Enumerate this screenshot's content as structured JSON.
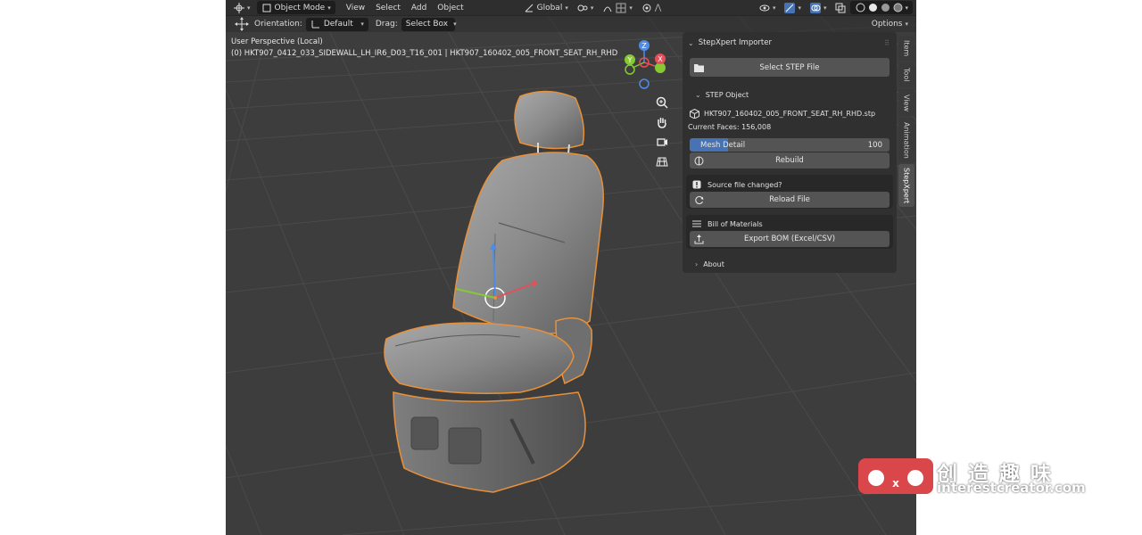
{
  "header": {
    "mode": "Object Mode",
    "menus": [
      "View",
      "Select",
      "Add",
      "Object"
    ],
    "transform_orientation": "Global",
    "icons": [
      "editor-type-icon",
      "object-mode-icon",
      "transform-orientation-icon",
      "pivot-icon",
      "snap-icon",
      "proportional-edit-icon",
      "visibility-icon",
      "gizmo-icon",
      "overlay-icon",
      "xray-icon",
      "shading-wireframe-icon",
      "shading-solid-icon",
      "shading-material-icon",
      "shading-rendered-icon"
    ]
  },
  "toolbar": {
    "orientation_label": "Orientation:",
    "orientation_value": "Default",
    "drag_label": "Drag:",
    "drag_value": "Select Box",
    "options_label": "Options"
  },
  "viewport": {
    "perspective": "User Perspective (Local)",
    "object_info": "(0) HKT907_0412_033_SIDEWALL_LH_IR6_D03_T16_001 | HKT907_160402_005_FRONT_SEAT_RH_RHD",
    "gizmo_labels": {
      "x": "X",
      "y": "Y",
      "z": "Z"
    },
    "nav_icons": [
      "zoom-icon",
      "pan-icon",
      "camera-icon",
      "grid-view-icon"
    ],
    "axis_colors": {
      "x": "#e44f5a",
      "y": "#86c933",
      "z": "#4d8de8"
    }
  },
  "panel": {
    "title": "StepXpert Importer",
    "select_step_label": "Select STEP File",
    "step_object_title": "STEP Object",
    "file_name": "HKT907_160402_005_FRONT_SEAT_RH_RHD.stp",
    "current_faces": "Current Faces: 156,008",
    "mesh_detail_label": "Mesh Detail",
    "mesh_detail_value": "100",
    "mesh_detail_fill": 0.19,
    "rebuild_label": "Rebuild",
    "source_changed": "Source file changed?",
    "reload_label": "Reload File",
    "bom_title": "Bill of Materials",
    "export_bom_label": "Export BOM (Excel/CSV)",
    "about_label": "About"
  },
  "tabs": [
    "Item",
    "Tool",
    "View",
    "Animation",
    "StepXpert"
  ],
  "watermark": {
    "chinese": "创 造 趣 味",
    "site": "interestcreator.com",
    "brand_color": "#d9474a"
  }
}
